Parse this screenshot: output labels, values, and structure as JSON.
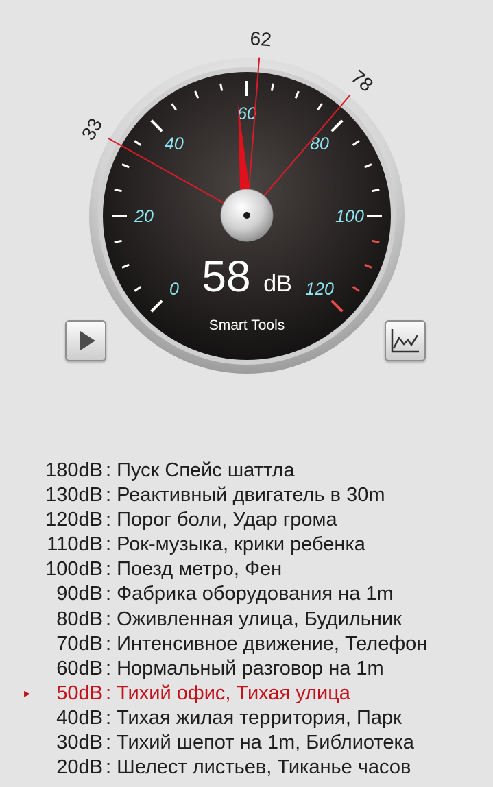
{
  "gauge": {
    "scale_labels": [
      "0",
      "20",
      "40",
      "60",
      "80",
      "100",
      "120"
    ],
    "scale_min": 0,
    "scale_max": 120,
    "current_value": 58,
    "min_marker": "33",
    "avg_marker": "62",
    "max_marker": "78",
    "reading_value": "58",
    "reading_unit": "dB",
    "brand": "Smart Tools",
    "colors": {
      "scale_label": "#8fe6f2",
      "needle": "#e0101c",
      "marker_line": "#d81c28",
      "danger_ticks": "#e84b4b"
    }
  },
  "buttons": {
    "play_icon": "play-icon",
    "graph_icon": "graph-icon"
  },
  "reference": [
    {
      "db": "180dB",
      "desc": ": Пуск Спейс шаттла"
    },
    {
      "db": "130dB",
      "desc": ": Реактивный двигатель в 30m"
    },
    {
      "db": "120dB",
      "desc": ": Порог боли, Удар грома"
    },
    {
      "db": "110dB",
      "desc": ": Рок-музыка, крики ребенка"
    },
    {
      "db": "100dB",
      "desc": ": Поезд метро, Фен"
    },
    {
      "db": "90dB",
      "desc": ": Фабрика оборудования на 1m"
    },
    {
      "db": "80dB",
      "desc": ": Оживленная улица, Будильник"
    },
    {
      "db": "70dB",
      "desc": ": Интенсивное движение, Телефон"
    },
    {
      "db": "60dB",
      "desc": ": Нормальный разговор на 1m"
    },
    {
      "db": "50dB",
      "desc": ": Тихий офис, Тихая улица",
      "active": true
    },
    {
      "db": "40dB",
      "desc": ": Тихая жилая территория, Парк"
    },
    {
      "db": "30dB",
      "desc": ": Тихий шепот на 1m, Библиотека"
    },
    {
      "db": "20dB",
      "desc": ": Шелест листьев, Тиканье часов"
    }
  ],
  "active_marker": "▸"
}
